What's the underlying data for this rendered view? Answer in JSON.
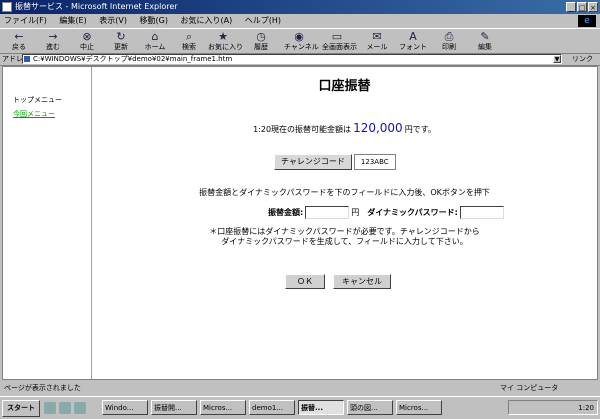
{
  "window": {
    "title": "振替サービス - Microsoft Internet Explorer",
    "controls": [
      "_",
      "□",
      "×"
    ]
  },
  "menu": {
    "items": [
      "ファイル(F)",
      "編集(E)",
      "表示(V)",
      "移動(G)",
      "お気に入り(A)",
      "ヘルプ(H)"
    ]
  },
  "toolbar": {
    "buttons": [
      {
        "label": "戻る",
        "icon": "back-arrow-icon",
        "glyph": "←"
      },
      {
        "label": "進む",
        "icon": "forward-arrow-icon",
        "glyph": "→"
      },
      {
        "label": "中止",
        "icon": "stop-icon",
        "glyph": "⊗"
      },
      {
        "label": "更新",
        "icon": "refresh-icon",
        "glyph": "↻"
      },
      {
        "label": "ホーム",
        "icon": "home-icon",
        "glyph": "⌂"
      },
      {
        "label": "検索",
        "icon": "search-icon",
        "glyph": "⌕"
      },
      {
        "label": "お気に入り",
        "icon": "favorites-icon",
        "glyph": "★"
      },
      {
        "label": "履歴",
        "icon": "history-icon",
        "glyph": "◷"
      },
      {
        "label": "チャンネル",
        "icon": "channel-icon",
        "glyph": "◉"
      },
      {
        "label": "全画面表示",
        "icon": "fullscreen-icon",
        "glyph": "▭"
      },
      {
        "label": "メール",
        "icon": "mail-icon",
        "glyph": "✉"
      },
      {
        "label": "フォント",
        "icon": "font-icon",
        "glyph": "A"
      },
      {
        "label": "印刷",
        "icon": "print-icon",
        "glyph": "⎙"
      },
      {
        "label": "編集",
        "icon": "edit-icon",
        "glyph": "✎"
      }
    ]
  },
  "address": {
    "label": "アドレス",
    "url": "C:¥WINDOWS¥デスクトップ¥demo¥02¥main_frame1.htm",
    "links_label": "リンク"
  },
  "sidebar": {
    "items": [
      {
        "label": "トップメニュー"
      },
      {
        "label": "今回メニュー"
      }
    ]
  },
  "page": {
    "title": "口座振替",
    "balance_prefix": "1:20現在の振替可能金額は",
    "balance_amount": "120,000",
    "balance_suffix": "円です。",
    "challenge_button": "チャレンジコード",
    "challenge_code": "123ABC",
    "instruction": "振替金額とダイナミックパスワードを下のフィールドに入力後、OKボタンを押下",
    "amount_label": "振替金額:",
    "amount_value": "",
    "yen": "円",
    "password_label": "ダイナミックパスワード:",
    "password_value": "",
    "note_line1": "＊口座振替にはダイナミックパスワードが必要です。チャレンジコードから",
    "note_line2": "ダイナミックパスワードを生成して、フィールドに入力して下さい。",
    "ok_button": "ＯＫ",
    "cancel_button": "キャンセル"
  },
  "statusbar": {
    "text": "ページが表示されました",
    "zone": "マイ コンピュータ"
  },
  "taskbar": {
    "start": "スタート",
    "tasks": [
      {
        "label": "Windo...",
        "active": false
      },
      {
        "label": "振替開...",
        "active": false
      },
      {
        "label": "Micros...",
        "active": false
      },
      {
        "label": "demo1...",
        "active": false
      },
      {
        "label": "振替...",
        "active": true
      },
      {
        "label": "頭の図...",
        "active": false
      },
      {
        "label": "Micros...",
        "active": false
      }
    ],
    "clock": "1:20"
  }
}
